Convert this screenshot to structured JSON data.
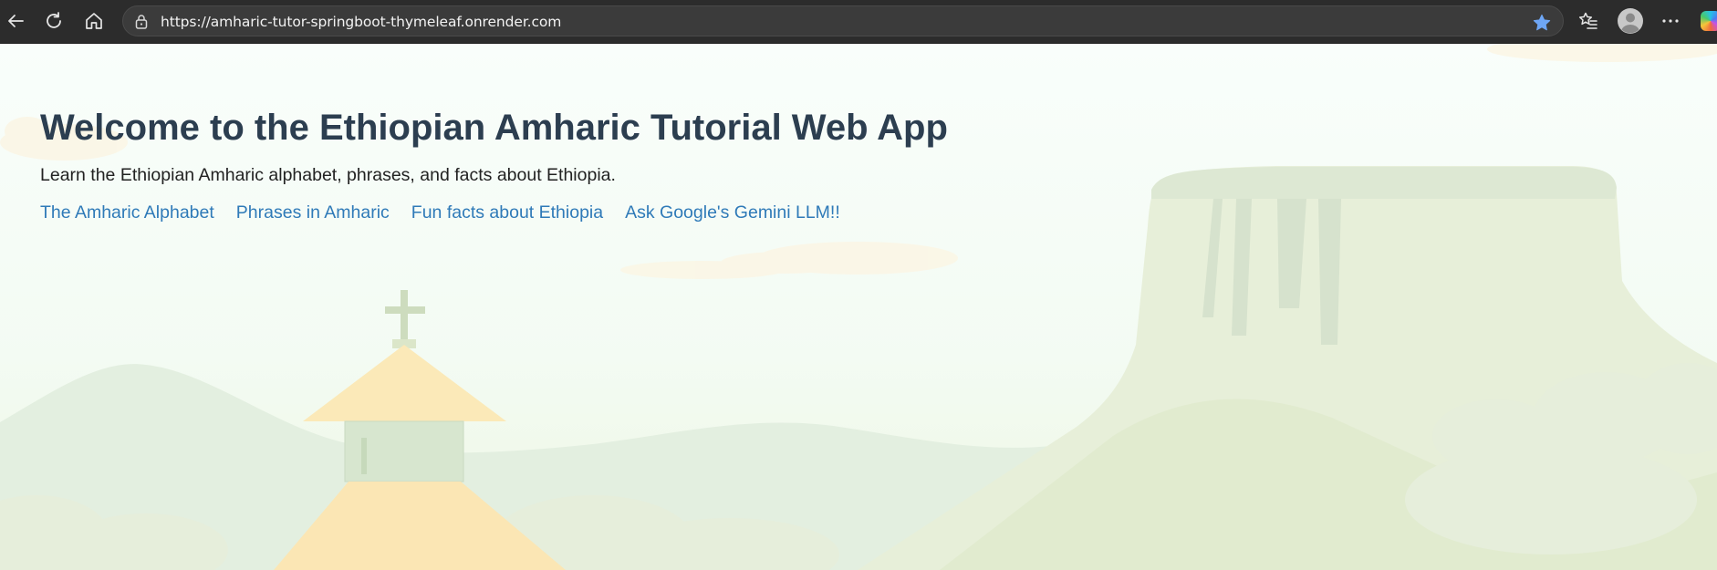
{
  "browser": {
    "url": "https://amharic-tutor-springboot-thymeleaf.onrender.com",
    "icons": {
      "back": "back-arrow-icon",
      "refresh": "refresh-icon",
      "home": "home-icon",
      "lock": "lock-icon",
      "favorite": "star-icon",
      "favorites": "favorites-list-icon",
      "profile": "profile-avatar-icon",
      "more": "more-dots-icon",
      "copilot": "copilot-icon"
    },
    "accent_color": "#5b9cf3"
  },
  "page": {
    "title": "Welcome to the Ethiopian Amharic Tutorial Web App",
    "subtitle": "Learn the Ethiopian Amharic alphabet, phrases, and facts about Ethiopia.",
    "links": [
      {
        "label": "The Amharic Alphabet"
      },
      {
        "label": "Phrases in Amharic"
      },
      {
        "label": "Fun facts about Ethiopia"
      },
      {
        "label": "Ask Google's Gemini LLM!!"
      }
    ],
    "title_color": "#2c3e50",
    "link_color": "#2f7ab8"
  }
}
